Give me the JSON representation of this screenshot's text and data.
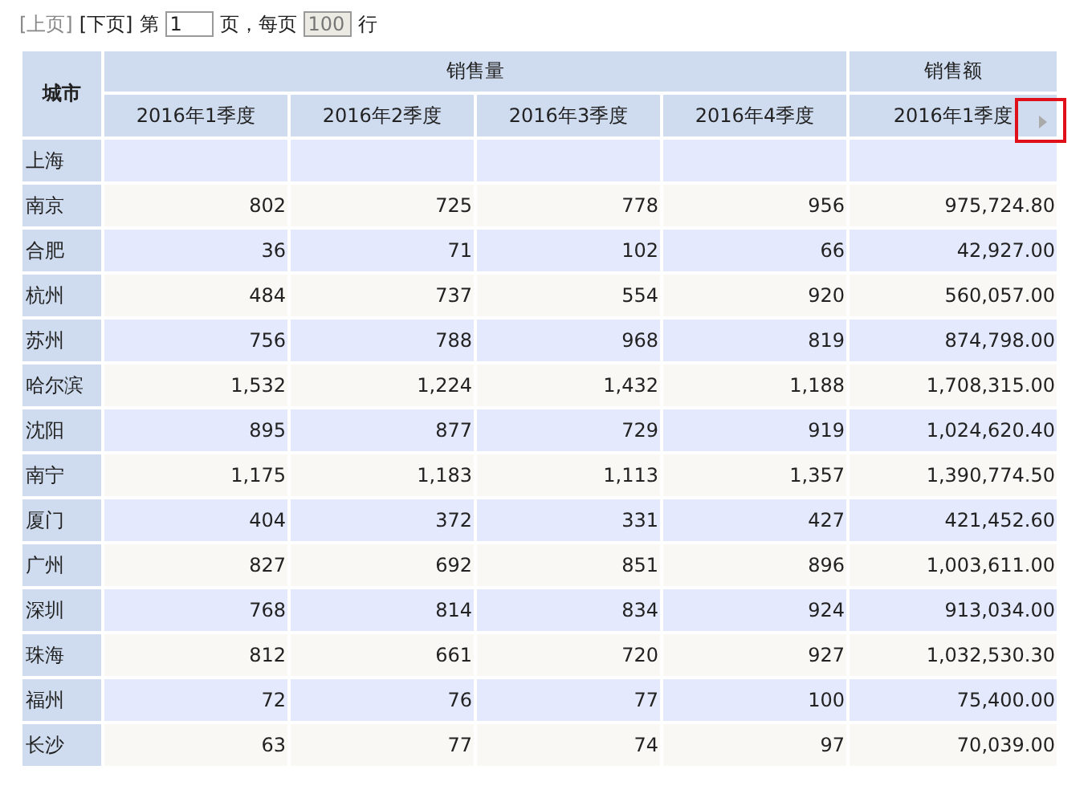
{
  "pager": {
    "prev": {
      "label": "[上页]",
      "disabled": true
    },
    "next": {
      "label": "[下页]",
      "disabled": false
    },
    "page_prefix": "第",
    "page": "1",
    "page_suffix": "页，每页",
    "page_size": {
      "value": "100",
      "disabled": true
    },
    "size_suffix": "行"
  },
  "table": {
    "corner": "城市",
    "groups": [
      {
        "label": "销售量",
        "columns": [
          "2016年1季度",
          "2016年2季度",
          "2016年3季度",
          "2016年4季度"
        ]
      },
      {
        "label": "销售额",
        "columns": [
          "2016年1季度"
        ]
      }
    ],
    "rows": [
      {
        "city": "上海",
        "cells": []
      },
      {
        "city": "南京",
        "cells": [
          "802",
          "725",
          "778",
          "956",
          "975,724.80"
        ]
      },
      {
        "city": "合肥",
        "cells": [
          "36",
          "71",
          "102",
          "66",
          "42,927.00"
        ]
      },
      {
        "city": "杭州",
        "cells": [
          "484",
          "737",
          "554",
          "920",
          "560,057.00"
        ]
      },
      {
        "city": "苏州",
        "cells": [
          "756",
          "788",
          "968",
          "819",
          "874,798.00"
        ]
      },
      {
        "city": "哈尔滨",
        "cells": [
          "1,532",
          "1,224",
          "1,432",
          "1,188",
          "1,708,315.00"
        ]
      },
      {
        "city": "沈阳",
        "cells": [
          "895",
          "877",
          "729",
          "919",
          "1,024,620.40"
        ]
      },
      {
        "city": "南宁",
        "cells": [
          "1,175",
          "1,183",
          "1,113",
          "1,357",
          "1,390,774.50"
        ]
      },
      {
        "city": "厦门",
        "cells": [
          "404",
          "372",
          "331",
          "427",
          "421,452.60"
        ]
      },
      {
        "city": "广州",
        "cells": [
          "827",
          "692",
          "851",
          "896",
          "1,003,611.00"
        ]
      },
      {
        "city": "深圳",
        "cells": [
          "768",
          "814",
          "834",
          "924",
          "913,034.00"
        ]
      },
      {
        "city": "珠海",
        "cells": [
          "812",
          "661",
          "720",
          "927",
          "1,032,530.30"
        ]
      },
      {
        "city": "福州",
        "cells": [
          "72",
          "76",
          "77",
          "100",
          "75,400.00"
        ]
      },
      {
        "city": "长沙",
        "cells": [
          "63",
          "77",
          "74",
          "97",
          "70,039.00"
        ]
      }
    ],
    "scroll_right": {
      "highlighted": true
    }
  }
}
